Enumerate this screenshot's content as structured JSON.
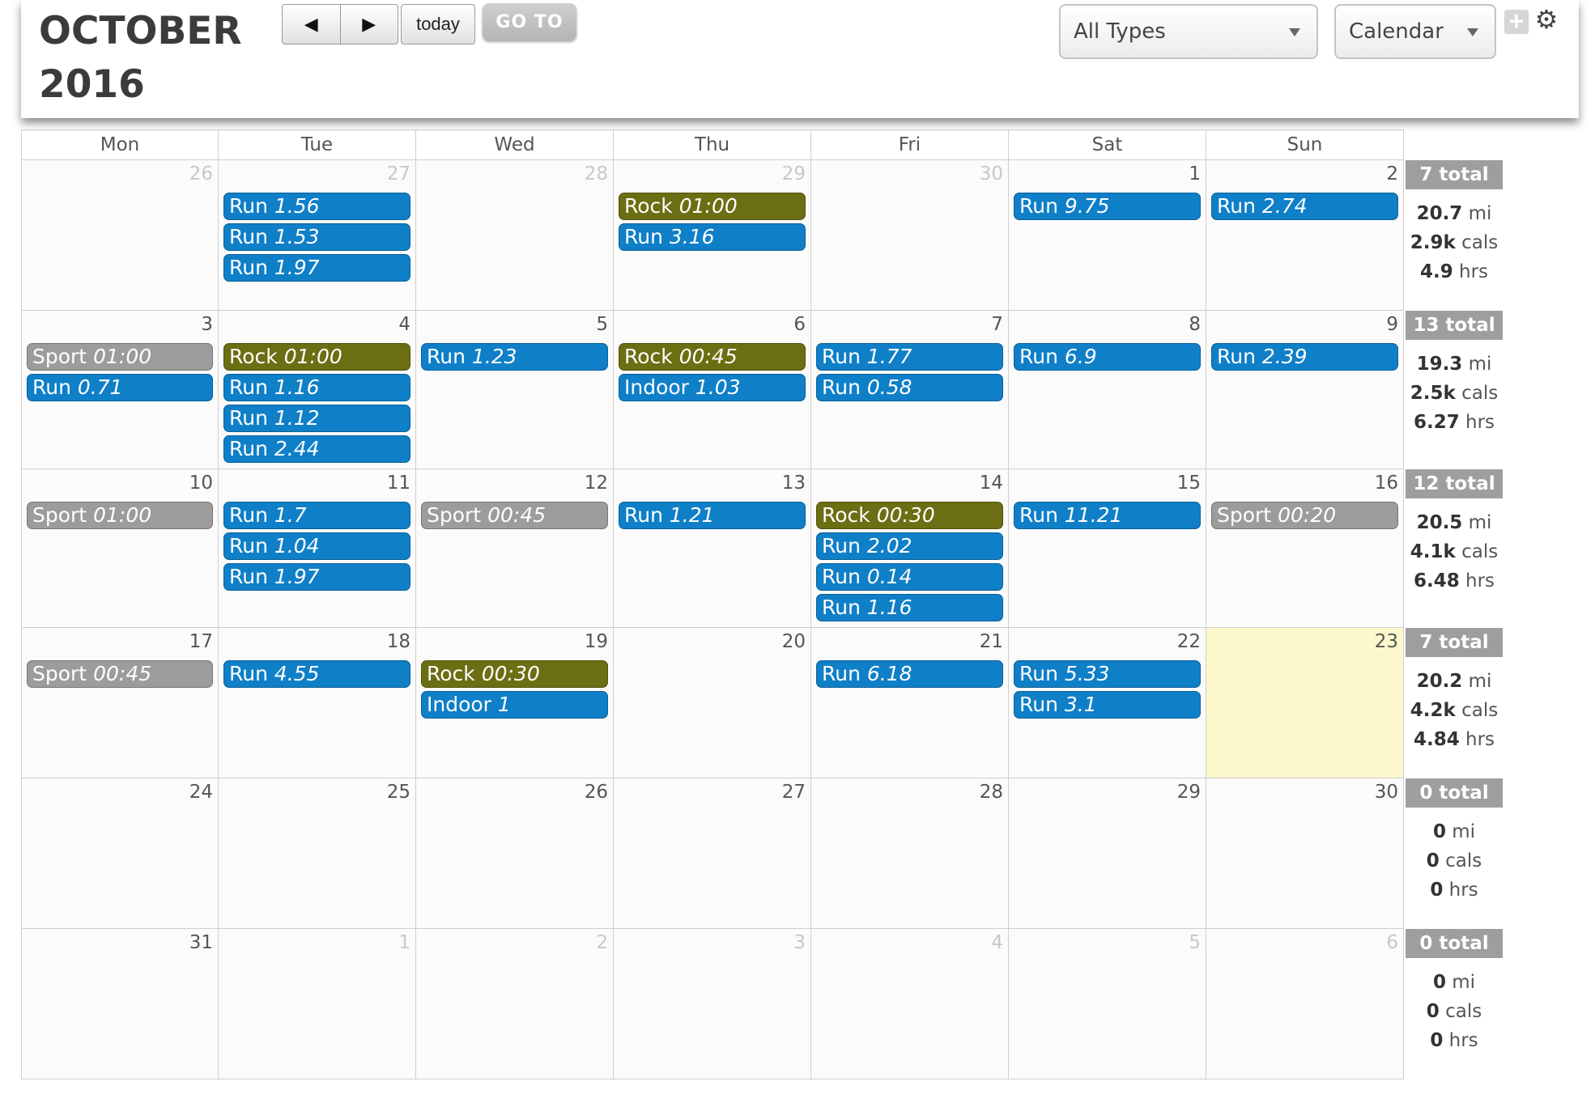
{
  "header": {
    "month": "OCTOBER",
    "year": "2016",
    "prev_label": "◀",
    "next_label": "▶",
    "today_label": "today",
    "goto_label": "GO TO",
    "type_select": "All Types",
    "view_select": "Calendar",
    "add_label": "+",
    "settings_label": "⚙"
  },
  "days_of_week": [
    "Mon",
    "Tue",
    "Wed",
    "Thu",
    "Fri",
    "Sat",
    "Sun"
  ],
  "colors": {
    "run": "#0f7fc8",
    "rock": "#6b6e12",
    "sport": "#9c9c9c",
    "today": "#fcf8cc"
  },
  "weeks": [
    {
      "days": [
        {
          "num": "26",
          "other": true,
          "events": []
        },
        {
          "num": "27",
          "other": true,
          "events": [
            {
              "type": "Run",
              "value": "1.56"
            },
            {
              "type": "Run",
              "value": "1.53"
            },
            {
              "type": "Run",
              "value": "1.97"
            }
          ]
        },
        {
          "num": "28",
          "other": true,
          "events": []
        },
        {
          "num": "29",
          "other": true,
          "events": [
            {
              "type": "Rock",
              "value": "01:00"
            },
            {
              "type": "Run",
              "value": "3.16"
            }
          ]
        },
        {
          "num": "30",
          "other": true,
          "events": []
        },
        {
          "num": "1",
          "other": false,
          "events": [
            {
              "type": "Run",
              "value": "9.75"
            }
          ]
        },
        {
          "num": "2",
          "other": false,
          "events": [
            {
              "type": "Run",
              "value": "2.74"
            }
          ]
        }
      ],
      "total": "7 total",
      "mi": "20.7",
      "cals": "2.9k",
      "hrs": "4.9"
    },
    {
      "days": [
        {
          "num": "3",
          "other": false,
          "events": [
            {
              "type": "Sport",
              "value": "01:00"
            },
            {
              "type": "Run",
              "value": "0.71"
            }
          ]
        },
        {
          "num": "4",
          "other": false,
          "events": [
            {
              "type": "Rock",
              "value": "01:00"
            },
            {
              "type": "Run",
              "value": "1.16"
            },
            {
              "type": "Run",
              "value": "1.12"
            },
            {
              "type": "Run",
              "value": "2.44"
            }
          ]
        },
        {
          "num": "5",
          "other": false,
          "events": [
            {
              "type": "Run",
              "value": "1.23"
            }
          ]
        },
        {
          "num": "6",
          "other": false,
          "events": [
            {
              "type": "Rock",
              "value": "00:45"
            },
            {
              "type": "Indoor",
              "value": "1.03"
            }
          ]
        },
        {
          "num": "7",
          "other": false,
          "events": [
            {
              "type": "Run",
              "value": "1.77"
            },
            {
              "type": "Run",
              "value": "0.58"
            }
          ]
        },
        {
          "num": "8",
          "other": false,
          "events": [
            {
              "type": "Run",
              "value": "6.9"
            }
          ]
        },
        {
          "num": "9",
          "other": false,
          "events": [
            {
              "type": "Run",
              "value": "2.39"
            }
          ]
        }
      ],
      "total": "13 total",
      "mi": "19.3",
      "cals": "2.5k",
      "hrs": "6.27"
    },
    {
      "days": [
        {
          "num": "10",
          "other": false,
          "events": [
            {
              "type": "Sport",
              "value": "01:00"
            }
          ]
        },
        {
          "num": "11",
          "other": false,
          "events": [
            {
              "type": "Run",
              "value": "1.7"
            },
            {
              "type": "Run",
              "value": "1.04"
            },
            {
              "type": "Run",
              "value": "1.97"
            }
          ]
        },
        {
          "num": "12",
          "other": false,
          "events": [
            {
              "type": "Sport",
              "value": "00:45"
            }
          ]
        },
        {
          "num": "13",
          "other": false,
          "events": [
            {
              "type": "Run",
              "value": "1.21"
            }
          ]
        },
        {
          "num": "14",
          "other": false,
          "events": [
            {
              "type": "Rock",
              "value": "00:30"
            },
            {
              "type": "Run",
              "value": "2.02"
            },
            {
              "type": "Run",
              "value": "0.14"
            },
            {
              "type": "Run",
              "value": "1.16"
            }
          ]
        },
        {
          "num": "15",
          "other": false,
          "events": [
            {
              "type": "Run",
              "value": "11.21"
            }
          ]
        },
        {
          "num": "16",
          "other": false,
          "events": [
            {
              "type": "Sport",
              "value": "00:20"
            }
          ]
        }
      ],
      "total": "12 total",
      "mi": "20.5",
      "cals": "4.1k",
      "hrs": "6.48"
    },
    {
      "days": [
        {
          "num": "17",
          "other": false,
          "events": [
            {
              "type": "Sport",
              "value": "00:45"
            }
          ]
        },
        {
          "num": "18",
          "other": false,
          "events": [
            {
              "type": "Run",
              "value": "4.55"
            }
          ]
        },
        {
          "num": "19",
          "other": false,
          "events": [
            {
              "type": "Rock",
              "value": "00:30"
            },
            {
              "type": "Indoor",
              "value": "1"
            }
          ]
        },
        {
          "num": "20",
          "other": false,
          "events": []
        },
        {
          "num": "21",
          "other": false,
          "events": [
            {
              "type": "Run",
              "value": "6.18"
            }
          ]
        },
        {
          "num": "22",
          "other": false,
          "events": [
            {
              "type": "Run",
              "value": "5.33"
            },
            {
              "type": "Run",
              "value": "3.1"
            }
          ]
        },
        {
          "num": "23",
          "other": false,
          "today": true,
          "events": []
        }
      ],
      "total": "7 total",
      "mi": "20.2",
      "cals": "4.2k",
      "hrs": "4.84"
    },
    {
      "days": [
        {
          "num": "24",
          "other": false,
          "events": []
        },
        {
          "num": "25",
          "other": false,
          "events": []
        },
        {
          "num": "26",
          "other": false,
          "events": []
        },
        {
          "num": "27",
          "other": false,
          "events": []
        },
        {
          "num": "28",
          "other": false,
          "events": []
        },
        {
          "num": "29",
          "other": false,
          "events": []
        },
        {
          "num": "30",
          "other": false,
          "events": []
        }
      ],
      "total": "0 total",
      "mi": "0",
      "cals": "0",
      "hrs": "0"
    },
    {
      "days": [
        {
          "num": "31",
          "other": false,
          "events": []
        },
        {
          "num": "1",
          "other": true,
          "events": []
        },
        {
          "num": "2",
          "other": true,
          "events": []
        },
        {
          "num": "3",
          "other": true,
          "events": []
        },
        {
          "num": "4",
          "other": true,
          "events": []
        },
        {
          "num": "5",
          "other": true,
          "events": []
        },
        {
          "num": "6",
          "other": true,
          "events": []
        }
      ],
      "total": "0 total",
      "mi": "0",
      "cals": "0",
      "hrs": "0"
    }
  ],
  "units": {
    "mi": "mi",
    "cals": "cals",
    "hrs": "hrs"
  }
}
